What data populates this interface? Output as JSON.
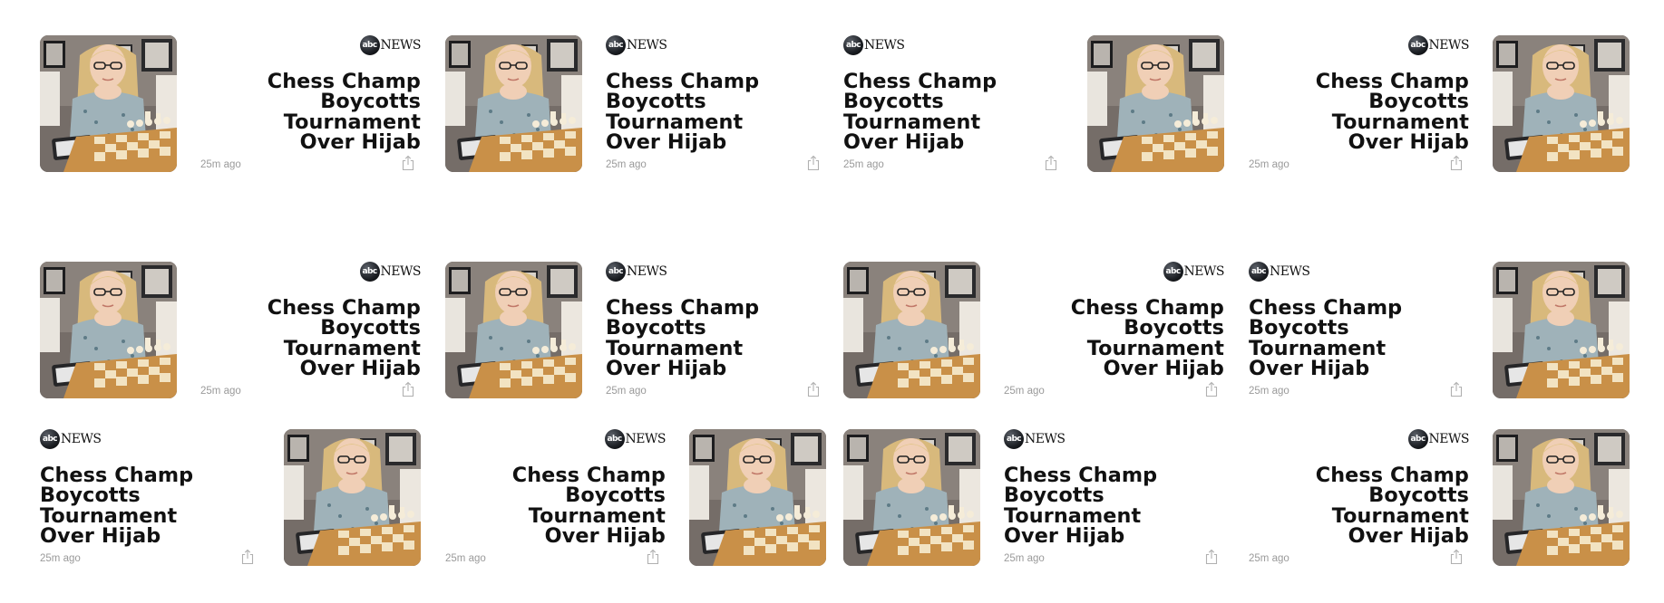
{
  "feed": {
    "cards": [
      {
        "row": 0,
        "col": 0,
        "image_side": "left",
        "text_align": "right",
        "source": {
          "logo": "abc",
          "word": "NEWS"
        },
        "headline": "Chess Champ\nBoycotts Tournament\nOver Hijab",
        "time": "25m ago",
        "share_icon": "share-icon"
      },
      {
        "row": 0,
        "col": 1,
        "image_side": "left",
        "text_align": "left",
        "source": {
          "logo": "abc",
          "word": "NEWS"
        },
        "headline": "Chess Champ\nBoycotts Tournament\nOver Hijab",
        "time": "25m ago",
        "share_icon": "share-icon"
      },
      {
        "row": 0,
        "col": 2,
        "image_side": "right",
        "text_align": "left",
        "source": {
          "logo": "abc",
          "word": "NEWS"
        },
        "headline": "Chess Champ\nBoycotts Tournament\nOver Hijab",
        "time": "25m ago",
        "share_icon": "share-icon"
      },
      {
        "row": 0,
        "col": 3,
        "image_side": "right",
        "text_align": "right",
        "source": {
          "logo": "abc",
          "word": "NEWS"
        },
        "headline": "Chess Champ\nBoycotts Tournament\nOver Hijab",
        "time": "25m ago",
        "share_icon": "share-icon"
      },
      {
        "row": 1,
        "col": 0,
        "image_side": "left",
        "text_align": "right",
        "source": {
          "logo": "abc",
          "word": "NEWS"
        },
        "headline": "Chess Champ\nBoycotts Tournament\nOver Hijab",
        "time": "25m ago",
        "share_icon": "share-icon"
      },
      {
        "row": 1,
        "col": 1,
        "image_side": "left",
        "text_align": "left",
        "source": {
          "logo": "abc",
          "word": "NEWS"
        },
        "headline": "Chess Champ\nBoycotts Tournament\nOver Hijab",
        "time": "25m ago",
        "share_icon": "share-icon"
      },
      {
        "row": 1,
        "col": 2,
        "image_side": "left",
        "text_align": "right",
        "source": {
          "logo": "abc",
          "word": "NEWS"
        },
        "headline": "Chess Champ\nBoycotts Tournament\nOver Hijab",
        "time": "25m ago",
        "share_icon": "share-icon"
      },
      {
        "row": 1,
        "col": 3,
        "image_side": "right",
        "text_align": "left",
        "source": {
          "logo": "abc",
          "word": "NEWS"
        },
        "headline": "Chess Champ\nBoycotts Tournament\nOver Hijab",
        "time": "25m ago",
        "share_icon": "share-icon"
      },
      {
        "row": 2,
        "col": 0,
        "image_side": "right",
        "text_align": "left",
        "source": {
          "logo": "abc",
          "word": "NEWS"
        },
        "headline": "Chess Champ\nBoycotts Tournament\nOver Hijab",
        "time": "25m ago",
        "share_icon": "share-icon"
      },
      {
        "row": 2,
        "col": 1,
        "image_side": "right",
        "text_align": "right",
        "source": {
          "logo": "abc",
          "word": "NEWS"
        },
        "headline": "Chess Champ\nBoycotts Tournament\nOver Hijab",
        "time": "25m ago",
        "share_icon": "share-icon"
      },
      {
        "row": 2,
        "col": 2,
        "image_side": "left",
        "text_align": "left",
        "source": {
          "logo": "abc",
          "word": "NEWS"
        },
        "headline": "Chess Champ\nBoycotts Tournament\nOver Hijab",
        "time": "25m ago",
        "share_icon": "share-icon"
      },
      {
        "row": 2,
        "col": 3,
        "image_side": "right",
        "text_align": "right",
        "source": {
          "logo": "abc",
          "word": "NEWS"
        },
        "headline": "Chess Champ\nBoycotts Tournament\nOver Hijab",
        "time": "25m ago",
        "share_icon": "share-icon"
      }
    ]
  }
}
